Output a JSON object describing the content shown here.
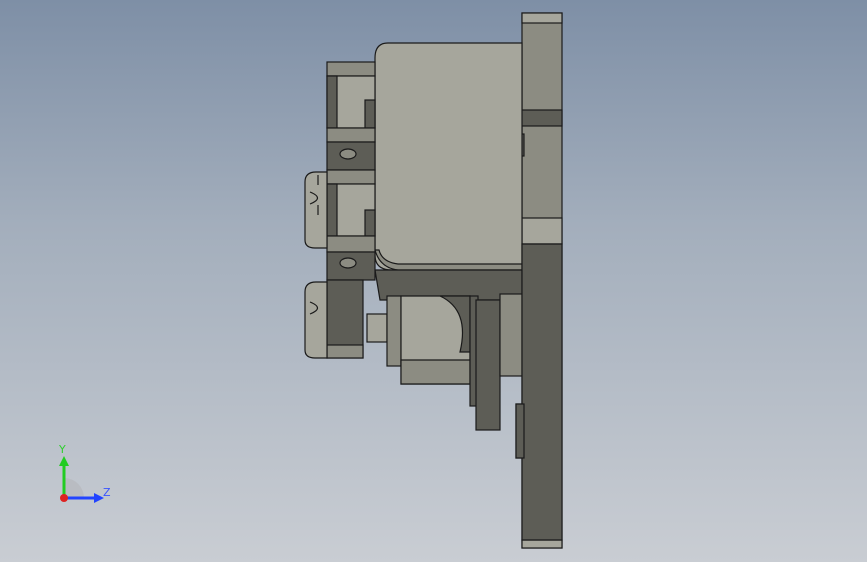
{
  "viewport": {
    "background_top": "#7e8fa6",
    "background_bottom": "#c9cdd3",
    "model_colors": {
      "face_light": "#a6a69c",
      "face_mid": "#8c8c82",
      "face_dark": "#5d5d56",
      "edge": "#1a1a1a"
    }
  },
  "triad": {
    "y_label": "Y",
    "z_label": "Z",
    "y_color": "#22cc22",
    "z_color": "#2244ff",
    "x_color": "#dd2222"
  }
}
